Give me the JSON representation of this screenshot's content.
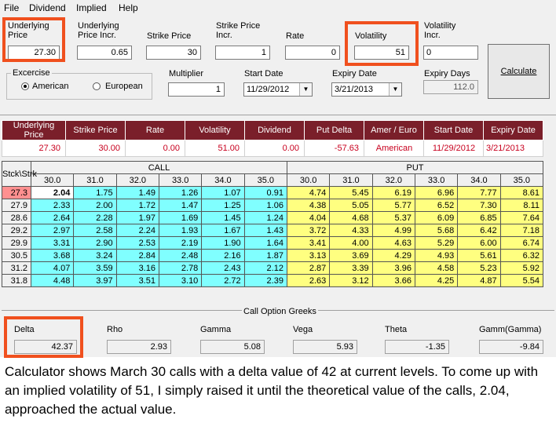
{
  "menu": [
    "File",
    "Dividend",
    "Implied",
    "Help"
  ],
  "inputs": {
    "underlying_price": {
      "label": "Underlying Price",
      "value": "27.30"
    },
    "underlying_price_incr": {
      "label": "Underlying Price Incr.",
      "value": "0.65"
    },
    "strike_price": {
      "label": "Strike Price",
      "value": "30"
    },
    "strike_price_incr": {
      "label": "Strike Price Incr.",
      "value": "1"
    },
    "rate": {
      "label": "Rate",
      "value": "0"
    },
    "volatility": {
      "label": "Volatility",
      "value": "51"
    },
    "volatility_incr": {
      "label": "Volatility Incr.",
      "value": "0"
    },
    "multiplier": {
      "label": "Multiplier",
      "value": "1"
    },
    "start_date": {
      "label": "Start Date",
      "value": "11/29/2012"
    },
    "expiry_date": {
      "label": "Expiry Date",
      "value": "3/21/2013"
    },
    "expiry_days": {
      "label": "Expiry Days",
      "value": "112.0"
    }
  },
  "exercise": {
    "label": "Excercise",
    "american": "American",
    "european": "European",
    "selected": "American"
  },
  "calculate_label": "Calculate",
  "summary": {
    "headers": [
      "Underlying Price",
      "Strike Price",
      "Rate",
      "Volatility",
      "Dividend",
      "Put Delta",
      "Amer / Euro",
      "Start Date",
      "Expiry Date"
    ],
    "values": [
      "27.30",
      "30.00",
      "0.00",
      "51.00",
      "0.00",
      "-57.63",
      "American",
      "11/29/2012",
      "3/21/2013"
    ]
  },
  "grid": {
    "corner": "Stck\\Strk",
    "call_label": "CALL",
    "put_label": "PUT",
    "strikes": [
      "30.0",
      "31.0",
      "32.0",
      "33.0",
      "34.0",
      "35.0"
    ],
    "rows": [
      {
        "stock": "27.3",
        "call": [
          "2.04",
          "1.75",
          "1.49",
          "1.26",
          "1.07",
          "0.91"
        ],
        "put": [
          "4.74",
          "5.45",
          "6.19",
          "6.96",
          "7.77",
          "8.61"
        ]
      },
      {
        "stock": "27.9",
        "call": [
          "2.33",
          "2.00",
          "1.72",
          "1.47",
          "1.25",
          "1.06"
        ],
        "put": [
          "4.38",
          "5.05",
          "5.77",
          "6.52",
          "7.30",
          "8.11"
        ]
      },
      {
        "stock": "28.6",
        "call": [
          "2.64",
          "2.28",
          "1.97",
          "1.69",
          "1.45",
          "1.24"
        ],
        "put": [
          "4.04",
          "4.68",
          "5.37",
          "6.09",
          "6.85",
          "7.64"
        ]
      },
      {
        "stock": "29.2",
        "call": [
          "2.97",
          "2.58",
          "2.24",
          "1.93",
          "1.67",
          "1.43"
        ],
        "put": [
          "3.72",
          "4.33",
          "4.99",
          "5.68",
          "6.42",
          "7.18"
        ]
      },
      {
        "stock": "29.9",
        "call": [
          "3.31",
          "2.90",
          "2.53",
          "2.19",
          "1.90",
          "1.64"
        ],
        "put": [
          "3.41",
          "4.00",
          "4.63",
          "5.29",
          "6.00",
          "6.74"
        ]
      },
      {
        "stock": "30.5",
        "call": [
          "3.68",
          "3.24",
          "2.84",
          "2.48",
          "2.16",
          "1.87"
        ],
        "put": [
          "3.13",
          "3.69",
          "4.29",
          "4.93",
          "5.61",
          "6.32"
        ]
      },
      {
        "stock": "31.2",
        "call": [
          "4.07",
          "3.59",
          "3.16",
          "2.78",
          "2.43",
          "2.12"
        ],
        "put": [
          "2.87",
          "3.39",
          "3.96",
          "4.58",
          "5.23",
          "5.92"
        ]
      },
      {
        "stock": "31.8",
        "call": [
          "4.48",
          "3.97",
          "3.51",
          "3.10",
          "2.72",
          "2.39"
        ],
        "put": [
          "2.63",
          "3.12",
          "3.66",
          "4.25",
          "4.87",
          "5.54"
        ]
      }
    ]
  },
  "greeks": {
    "title": "Call Option Greeks",
    "items": [
      {
        "label": "Delta",
        "value": "42.37"
      },
      {
        "label": "Rho",
        "value": "2.93"
      },
      {
        "label": "Gamma",
        "value": "5.08"
      },
      {
        "label": "Vega",
        "value": "5.93"
      },
      {
        "label": "Theta",
        "value": "-1.35"
      },
      {
        "label": "Gamm(Gamma)",
        "value": "-9.84"
      }
    ]
  },
  "caption": "Calculator shows March 30 calls with a delta value of 42 at current levels. To come up with an implied volatility of 51, I simply raised it until the theoretical value of the calls, 2.04, approached the actual value.",
  "colors": {
    "highlight": "#f0501e",
    "header_bg": "#7a1f2a",
    "call_cell": "#80ffff",
    "put_cell": "#ffff80",
    "summary_text": "#c8001e"
  }
}
